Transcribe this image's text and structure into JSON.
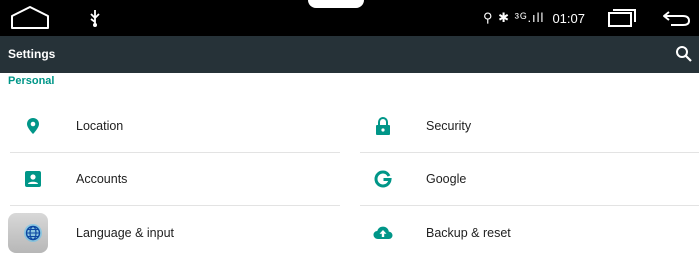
{
  "status_bar": {
    "icons_text": "⚲ ✱ ³ᴳ.ıll",
    "time": "01:07"
  },
  "toolbar": {
    "title": "Settings"
  },
  "section": {
    "title": "Personal"
  },
  "items": [
    {
      "label": "Location",
      "icon": "location-icon"
    },
    {
      "label": "Security",
      "icon": "lock-icon"
    },
    {
      "label": "Accounts",
      "icon": "account-icon"
    },
    {
      "label": "Google",
      "icon": "google-icon"
    },
    {
      "label": "Language & input",
      "icon": "globe-icon"
    },
    {
      "label": "Backup & reset",
      "icon": "cloud-upload-icon"
    }
  ],
  "colors": {
    "accent": "#009688",
    "toolbar": "#263238",
    "status_bar": "#000000"
  }
}
